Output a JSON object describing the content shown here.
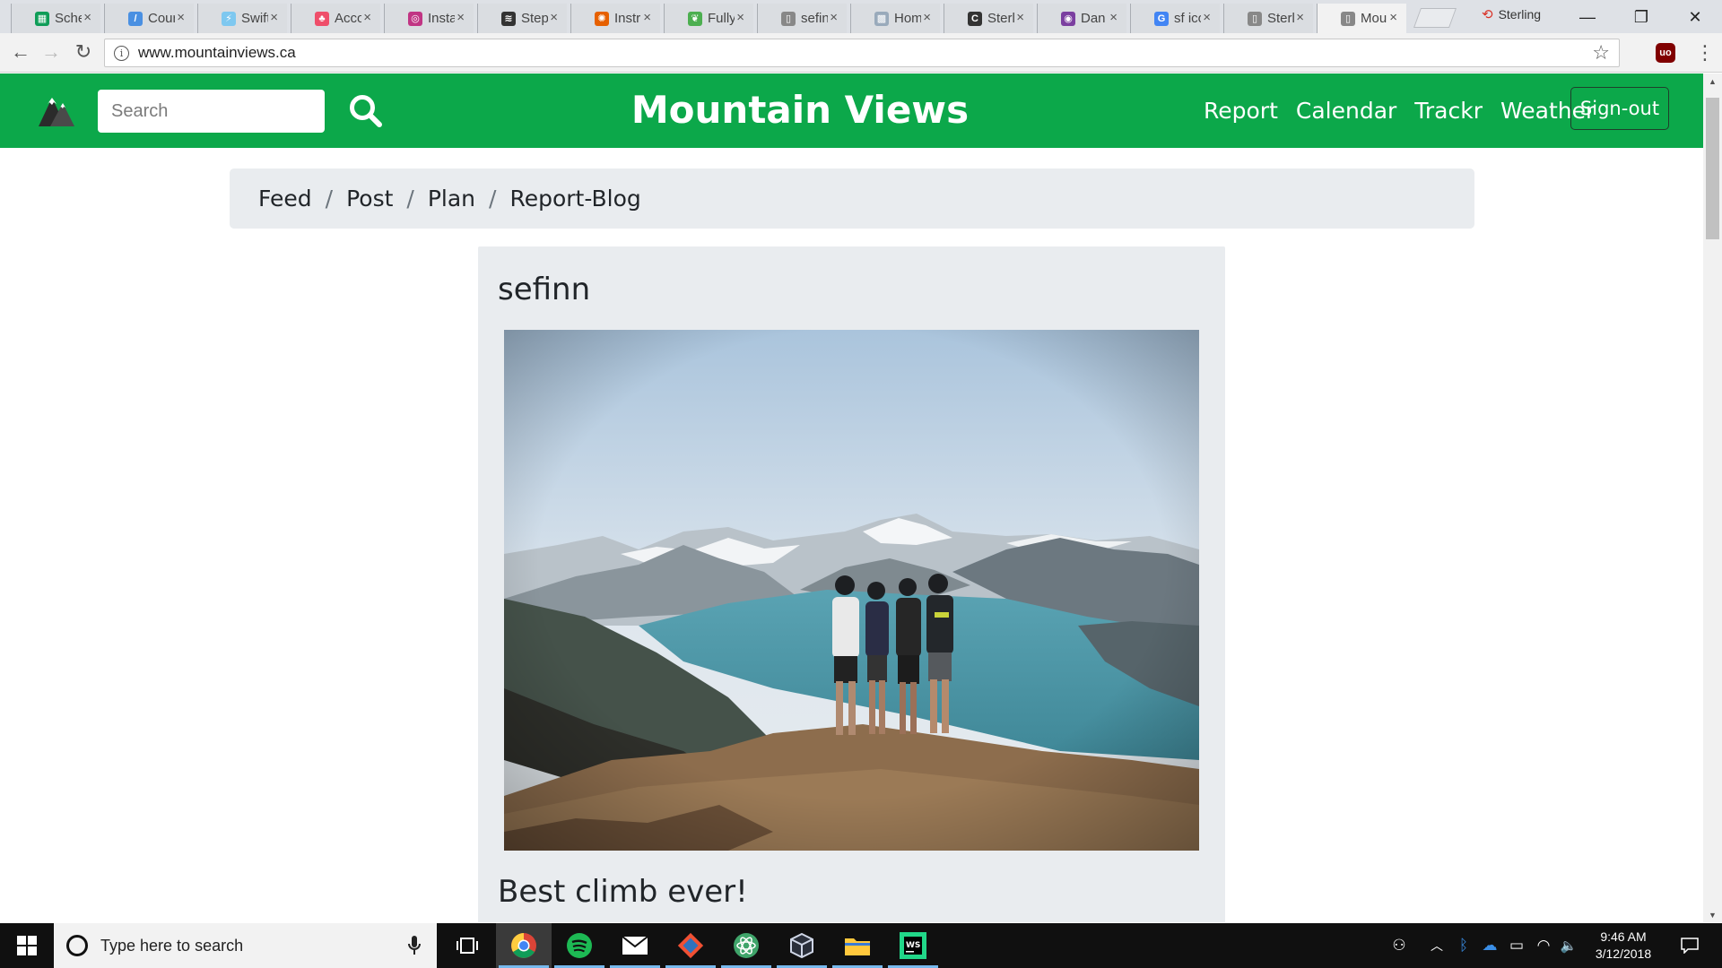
{
  "browser": {
    "tabs": [
      {
        "title": "Schedule",
        "icon": "sheets-icon",
        "color": "#0f9d58",
        "glyph": "▦"
      },
      {
        "title": "Courses",
        "icon": "courses-icon",
        "color": "#4a90e2",
        "glyph": "/"
      },
      {
        "title": "Swift",
        "icon": "swift-icon",
        "color": "#7ec8f0",
        "glyph": "⚡"
      },
      {
        "title": "Account",
        "icon": "account-icon",
        "color": "#ef4e6a",
        "glyph": "♣"
      },
      {
        "title": "Instagram",
        "icon": "instagram-icon",
        "color": "#c13584",
        "glyph": "◎"
      },
      {
        "title": "Steps",
        "icon": "steps-icon",
        "color": "#333333",
        "glyph": "≋"
      },
      {
        "title": "Instructure",
        "icon": "instructure-icon",
        "color": "#e66000",
        "glyph": "✺"
      },
      {
        "title": "Fully",
        "icon": "leaf-icon",
        "color": "#4caf50",
        "glyph": "❦"
      },
      {
        "title": "sefinn",
        "icon": "document-icon",
        "color": "#888888",
        "glyph": "▯"
      },
      {
        "title": "Home",
        "icon": "map-icon",
        "color": "#9ab",
        "glyph": "▩"
      },
      {
        "title": "Sterling",
        "icon": "c-icon",
        "color": "#333333",
        "glyph": "C"
      },
      {
        "title": "Dan",
        "icon": "dan-icon",
        "color": "#7b3fa0",
        "glyph": "◉"
      },
      {
        "title": "sf icons",
        "icon": "google-icon",
        "color": "#4285f4",
        "glyph": "G"
      },
      {
        "title": "Sterling",
        "icon": "document-icon",
        "color": "#888888",
        "glyph": "▯"
      },
      {
        "title": "Mountain Views",
        "icon": "document-icon",
        "color": "#888888",
        "glyph": "▯",
        "active": true
      }
    ],
    "profile_name": "Sterling",
    "url": "www.mountainviews.ca"
  },
  "site": {
    "title": "Mountain Views",
    "search_placeholder": "Search",
    "nav": {
      "report": "Report",
      "calendar": "Calendar",
      "trackr": "Trackr",
      "weather": "Weather"
    },
    "signout": "Sign-out",
    "brand_color": "#0ca84a"
  },
  "breadcrumb": {
    "feed": "Feed",
    "post": "Post",
    "plan": "Plan",
    "report_blog": "Report-Blog",
    "separator": "/"
  },
  "post": {
    "author": "sefinn",
    "caption": "Best climb ever!"
  },
  "taskbar": {
    "search_placeholder": "Type here to search",
    "time": "9:46 AM",
    "date": "3/12/2018"
  }
}
